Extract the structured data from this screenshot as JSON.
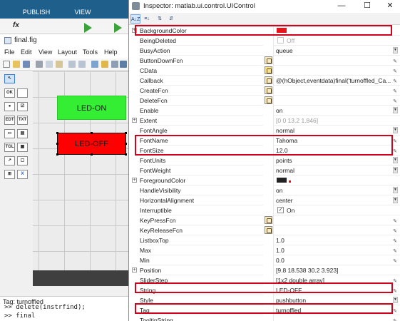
{
  "background": {
    "ribbon_tabs": [
      "PUBLISH",
      "VIEW"
    ],
    "fx": "fx",
    "figure_title": "final.fig",
    "menu": [
      "File",
      "Edit",
      "View",
      "Layout",
      "Tools",
      "Help"
    ],
    "palette": [
      {
        "id": "pointer",
        "label": "↖"
      },
      {
        "id": "pushbutton",
        "label": "OK"
      },
      {
        "id": "radio",
        "label": "●"
      },
      {
        "id": "checkbox",
        "label": "☑"
      },
      {
        "id": "edit",
        "label": "EDT"
      },
      {
        "id": "text",
        "label": "TXT"
      },
      {
        "id": "popup",
        "label": "▭"
      },
      {
        "id": "listbox",
        "label": "▤"
      },
      {
        "id": "toggle",
        "label": "TGL"
      },
      {
        "id": "table",
        "label": "▦"
      },
      {
        "id": "axes",
        "label": "↗"
      },
      {
        "id": "panel",
        "label": "▢"
      },
      {
        "id": "buttongroup",
        "label": "⊞"
      },
      {
        "id": "activex",
        "label": "X"
      }
    ],
    "buttons": {
      "on": "LED-ON",
      "off": "LED-OFF"
    },
    "status": "Tag: turnoffled",
    "cmd_lines": [
      ">> delete(instrfind);",
      ">> final"
    ]
  },
  "inspector": {
    "title": "Inspector:  matlab.ui.control.UIControl",
    "window_controls": {
      "minimize": "—",
      "maximize": "☐",
      "close": "✕"
    },
    "toolbar": [
      "A↓Z",
      "≡↓",
      "⇅",
      "⇵"
    ],
    "colors": {
      "background_swatch": "#e8141a",
      "foreground_swatch": "#222222",
      "highlight": "#d0021b"
    },
    "properties": [
      {
        "name": "BackgroundColor",
        "expandable": true,
        "value": "",
        "icon": "color",
        "swatch": "#e8141a"
      },
      {
        "name": "BeingDeleted",
        "value": "Off",
        "checkbox": "off"
      },
      {
        "name": "BusyAction",
        "value": "queue",
        "control": "dropdown"
      },
      {
        "name": "ButtonDownFcn",
        "value": "",
        "icon": "callback",
        "control": "edit"
      },
      {
        "name": "CData",
        "value": "",
        "icon": "grid",
        "control": "edit"
      },
      {
        "name": "Callback",
        "value": "@(hObject,eventdata)final('turnoffled_Ca...",
        "icon": "callback",
        "control": "edit"
      },
      {
        "name": "CreateFcn",
        "value": "",
        "icon": "callback",
        "control": "edit"
      },
      {
        "name": "DeleteFcn",
        "value": "",
        "icon": "callback",
        "control": "edit"
      },
      {
        "name": "Enable",
        "value": "on",
        "control": "dropdown"
      },
      {
        "name": "Extent",
        "expandable": true,
        "value": "[0 0 13.2 1.846]",
        "gray": true
      },
      {
        "name": "FontAngle",
        "value": "normal",
        "control": "dropdown"
      },
      {
        "name": "FontName",
        "value": "Tahoma",
        "control": "edit"
      },
      {
        "name": "FontSize",
        "value": "12.0",
        "control": "edit"
      },
      {
        "name": "FontUnits",
        "value": "points",
        "control": "dropdown"
      },
      {
        "name": "FontWeight",
        "value": "normal",
        "control": "dropdown"
      },
      {
        "name": "ForegroundColor",
        "expandable": true,
        "value": "",
        "icon": "color",
        "swatch": "#222222"
      },
      {
        "name": "HandleVisibility",
        "value": "on",
        "control": "dropdown"
      },
      {
        "name": "HorizontalAlignment",
        "value": "center",
        "control": "dropdown"
      },
      {
        "name": "Interruptible",
        "value": "On",
        "checkbox": "on"
      },
      {
        "name": "KeyPressFcn",
        "value": "",
        "icon": "callback",
        "control": "edit"
      },
      {
        "name": "KeyReleaseFcn",
        "value": "",
        "icon": "callback",
        "control": "edit"
      },
      {
        "name": "ListboxTop",
        "value": "1.0",
        "control": "edit"
      },
      {
        "name": "Max",
        "value": "1.0",
        "control": "edit"
      },
      {
        "name": "Min",
        "value": "0.0",
        "control": "edit"
      },
      {
        "name": "Position",
        "expandable": true,
        "value": "[9.8 18.538 30.2 3.923]"
      },
      {
        "name": "SliderStep",
        "value": "[1x2  double array]",
        "control": "edit"
      },
      {
        "name": "String",
        "value": "LED-OFF",
        "control": "edit"
      },
      {
        "name": "Style",
        "value": "pushbutton",
        "control": "dropdown"
      },
      {
        "name": "Tag",
        "value": "turnoffled",
        "control": "edit"
      },
      {
        "name": "TooltipString",
        "value": "",
        "control": "edit"
      }
    ]
  }
}
